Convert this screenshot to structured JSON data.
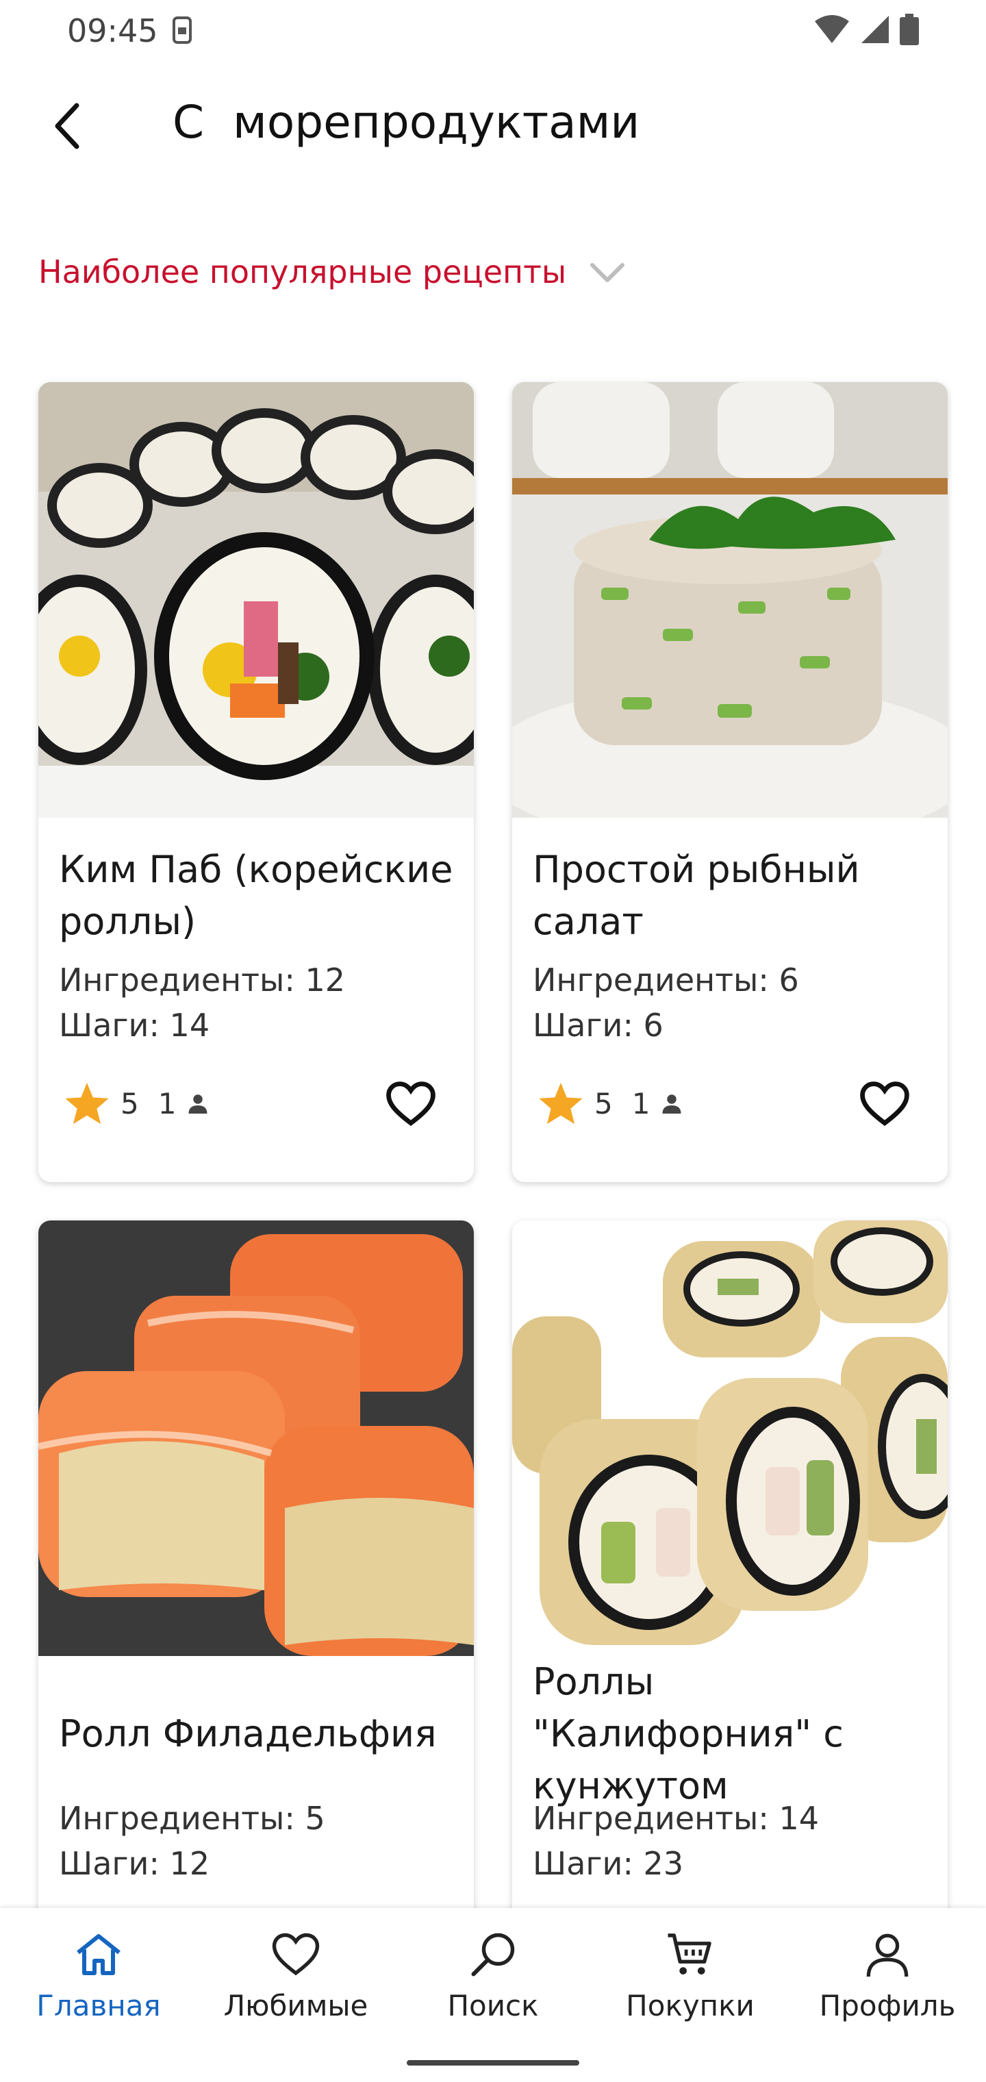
{
  "status_bar": {
    "time": "09:45"
  },
  "header": {
    "title": "С  морепродуктами"
  },
  "sort": {
    "label": "Наиболее популярные рецепты"
  },
  "recipes": [
    {
      "title": "Ким Паб (корейские роллы)",
      "ingredients": "Ингредиенты: 12",
      "steps": "Шаги: 14",
      "rating": "5",
      "reviews": "1"
    },
    {
      "title": "Простой рыбный салат",
      "ingredients": "Ингредиенты: 6",
      "steps": "Шаги: 6",
      "rating": "5",
      "reviews": "1"
    },
    {
      "title": "Ролл Филадельфия",
      "ingredients": "Ингредиенты: 5",
      "steps": "Шаги: 12"
    },
    {
      "title": "Роллы \"Калифорния\" с кунжутом",
      "ingredients": "Ингредиенты: 14",
      "steps": "Шаги: 23"
    }
  ],
  "nav": {
    "items": [
      {
        "label": "Главная",
        "icon": "home-icon",
        "active": true
      },
      {
        "label": "Любимые",
        "icon": "heart-icon"
      },
      {
        "label": "Поиск",
        "icon": "search-icon"
      },
      {
        "label": "Покупки",
        "icon": "cart-icon"
      },
      {
        "label": "Профиль",
        "icon": "profile-icon"
      }
    ]
  },
  "colors": {
    "accent": "#c8102e",
    "nav_active": "#1565c0",
    "star": "#f5a623"
  }
}
